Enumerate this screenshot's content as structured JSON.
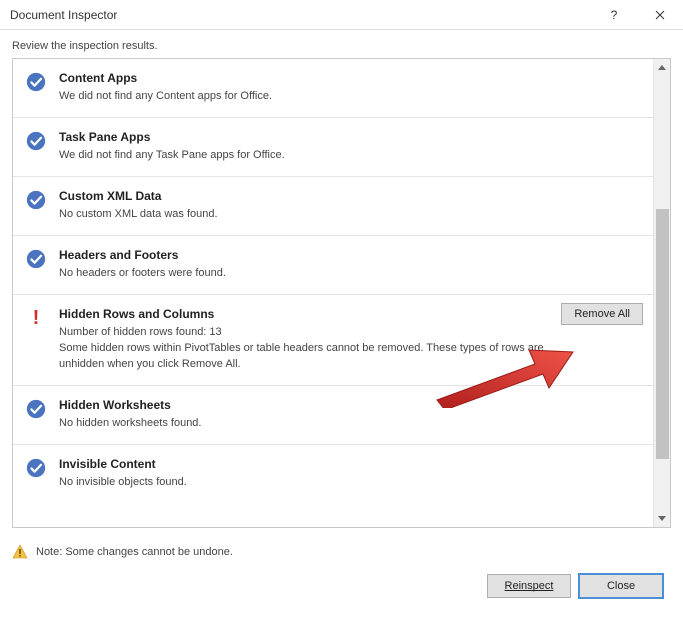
{
  "title": "Document Inspector",
  "instructions": "Review the inspection results.",
  "results": [
    {
      "title": "Content Apps",
      "desc": "We did not find any Content apps for Office.",
      "status": "ok"
    },
    {
      "title": "Task Pane Apps",
      "desc": "We did not find any Task Pane apps for Office.",
      "status": "ok"
    },
    {
      "title": "Custom XML Data",
      "desc": "No custom XML data was found.",
      "status": "ok"
    },
    {
      "title": "Headers and Footers",
      "desc": "No headers or footers were found.",
      "status": "ok"
    },
    {
      "title": "Hidden Rows and Columns",
      "desc": "Number of hidden rows found: 13\nSome hidden rows within PivotTables or table headers cannot be removed. These types of rows are unhidden when you click Remove All.",
      "status": "alert",
      "action": "Remove All"
    },
    {
      "title": "Hidden Worksheets",
      "desc": "No hidden worksheets found.",
      "status": "ok"
    },
    {
      "title": "Invisible Content",
      "desc": "No invisible objects found.",
      "status": "ok"
    }
  ],
  "footer_note": "Note: Some changes cannot be undone.",
  "buttons": {
    "reinspect": "Reinspect",
    "close": "Close"
  }
}
